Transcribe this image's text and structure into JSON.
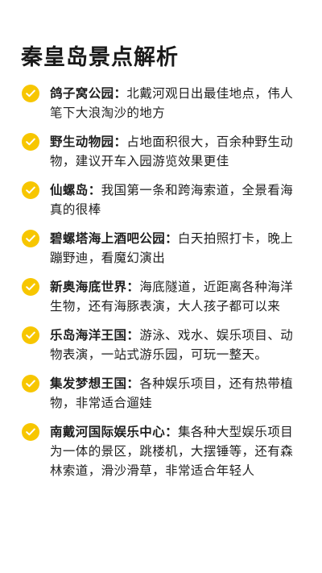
{
  "title": "秦皇岛景点解析",
  "icon": "check-circle-icon",
  "accent_color": "#f7c600",
  "separator": "：",
  "items": [
    {
      "name": "鸽子窝公园",
      "desc": "北戴河观日出最佳地点，伟人笔下大浪淘沙的地方"
    },
    {
      "name": "野生动物园",
      "desc": "占地面积很大，百余种野生动物，建议开车入园游览效果更佳"
    },
    {
      "name": "仙螺岛",
      "desc": "我国第一条和跨海索道，全景看海真的很棒"
    },
    {
      "name": "碧螺塔海上酒吧公园",
      "desc": "白天拍照打卡，晚上蹦野迪，看魔幻演出"
    },
    {
      "name": "新奥海底世界",
      "desc": "海底隧道，近距离各种海洋生物，还有海豚表演，大人孩子都可以来"
    },
    {
      "name": "乐岛海洋王国",
      "desc": "游泳、戏水、娱乐项目、动物表演，一站式游乐园，可玩一整天。"
    },
    {
      "name": "集发梦想王国",
      "desc": "各种娱乐项目，还有热带植物，非常适合遛娃"
    },
    {
      "name": "南戴河国际娱乐中心",
      "desc": "集各种大型娱乐项目为一体的景区，跳楼机，大摆锤等，还有森林索道，滑沙滑草，非常适合年轻人"
    }
  ]
}
